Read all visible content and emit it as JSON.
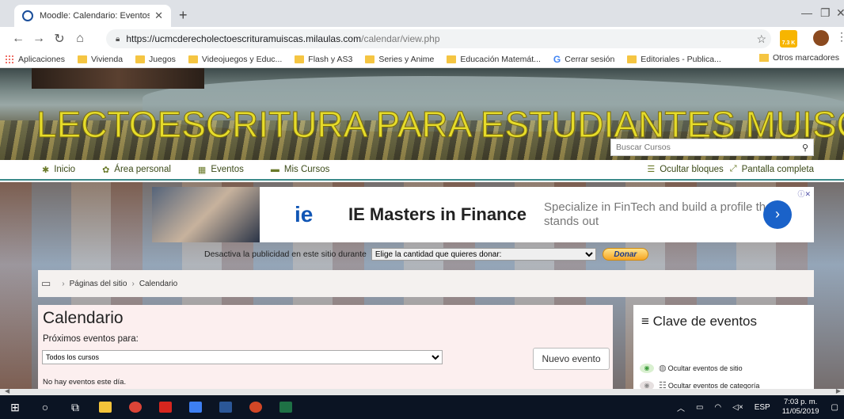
{
  "browser": {
    "tab_title": "Moodle: Calendario: Eventos pró",
    "new_tab": "+",
    "url_host": "https://ucmcderecholectoescrituramuiscas.milaulas.com",
    "url_path": "/calendar/view.php",
    "ext_badge": "7.3 K",
    "bookmarks": [
      {
        "label": "Aplicaciones",
        "icon": "apps-icon"
      },
      {
        "label": "Vivienda",
        "icon": "folder-icon"
      },
      {
        "label": "Juegos",
        "icon": "folder-icon"
      },
      {
        "label": "Videojuegos y Educ...",
        "icon": "folder-icon"
      },
      {
        "label": "Flash y AS3",
        "icon": "folder-icon"
      },
      {
        "label": "Series y Anime",
        "icon": "folder-icon"
      },
      {
        "label": "Educación Matemát...",
        "icon": "folder-icon"
      },
      {
        "label": "Cerrar sesión",
        "icon": "google-icon"
      },
      {
        "label": "Editoriales - Publica...",
        "icon": "folder-icon"
      }
    ],
    "bookmarks_more": "»",
    "other_bookmarks": "Otros marcadores"
  },
  "site": {
    "title": "LECTOESCRITURA PARA ESTUDIANTES MUISCAS DE",
    "search_placeholder": "Buscar Cursos",
    "nav": [
      {
        "label": "Inicio",
        "icon": "home-icon"
      },
      {
        "label": "Área personal",
        "icon": "dashboard-icon"
      },
      {
        "label": "Eventos",
        "icon": "calendar-icon"
      },
      {
        "label": "Mis Cursos",
        "icon": "courses-icon"
      }
    ],
    "nav_right": [
      {
        "label": "Ocultar bloques",
        "icon": "blocks-icon"
      },
      {
        "label": "Pantalla completa",
        "icon": "fullscreen-icon"
      }
    ]
  },
  "ad": {
    "logo": "ie",
    "title": "IE Masters in Finance",
    "subtitle": "Specialize in FinTech and build a profile that stands out",
    "button": "›"
  },
  "donate": {
    "text": "Desactiva la publicidad en este sitio durante",
    "select_value": "Elige la cantidad que quieres donar:",
    "button": "Donar"
  },
  "breadcrumb": {
    "items": [
      "Páginas del sitio",
      "Calendario"
    ]
  },
  "calendar": {
    "heading": "Calendario",
    "upcoming_label": "Próximos eventos para:",
    "course_select": "Todos los cursos",
    "new_event_button": "Nuevo evento",
    "no_events": "No hay eventos este día."
  },
  "event_key": {
    "heading": "Clave de eventos",
    "rows": [
      {
        "label": "Ocultar eventos de sitio"
      },
      {
        "label": "Ocultar eventos de categoría"
      }
    ]
  },
  "taskbar": {
    "lang": "ESP",
    "time": "7:03 p. m.",
    "date": "11/05/2019"
  }
}
